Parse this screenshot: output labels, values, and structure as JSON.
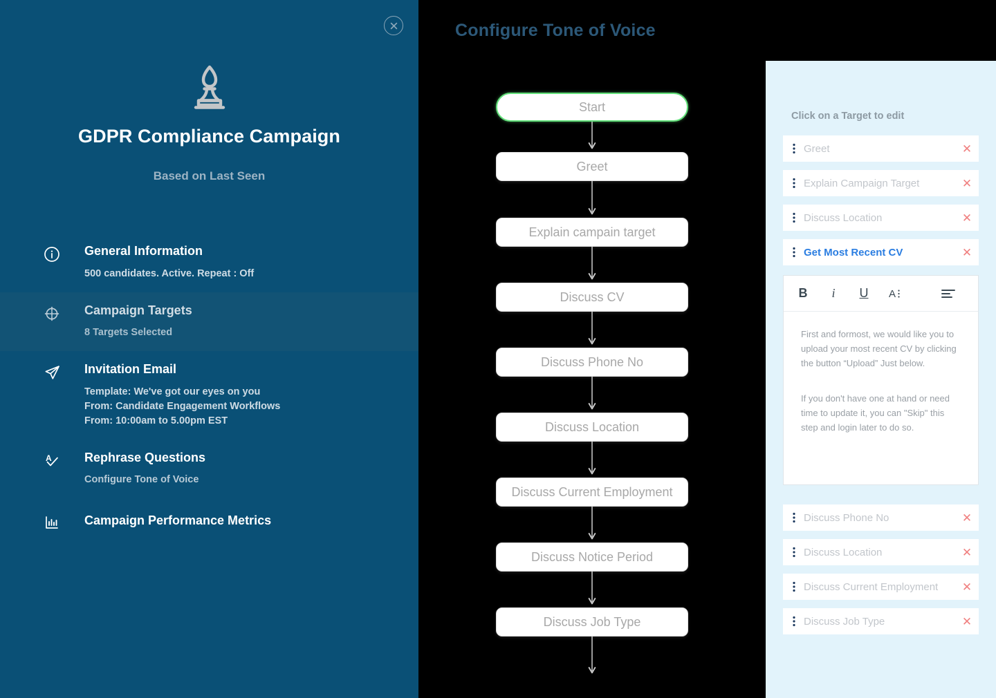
{
  "sidebar": {
    "close_icon": "close-circle-icon",
    "brand_icon": "chess-bishop-icon",
    "title": "GDPR Compliance Campaign",
    "subtitle": "Based on Last Seen",
    "items": [
      {
        "icon": "info-circle-icon",
        "label": "General Information",
        "sub": "500 candidates. Active. Repeat : Off",
        "active": false
      },
      {
        "icon": "target-crosshair-icon",
        "label": "Campaign Targets",
        "sub": "8 Targets Selected",
        "active": true
      },
      {
        "icon": "paper-plane-icon",
        "label": "Invitation Email",
        "sub_line1": "Template: We've got our eyes on you",
        "sub_line2": "From: Candidate Engagement Workflows",
        "sub_line3": "From: 10:00am to 5.00pm EST",
        "active": false
      },
      {
        "icon": "rephrase-a-check-icon",
        "label": "Rephrase Questions",
        "sub": "Configure Tone of Voice",
        "active": false
      },
      {
        "icon": "bar-chart-icon",
        "label": "Campaign Performance Metrics",
        "sub": "",
        "active": false
      }
    ]
  },
  "topbar": {
    "title": "Configure Tone of Voice"
  },
  "flow": {
    "nodes": [
      {
        "label": "Start",
        "type": "start"
      },
      {
        "label": "Greet",
        "type": "step"
      },
      {
        "label": "Explain campain target",
        "type": "step"
      },
      {
        "label": "Discuss CV",
        "type": "step"
      },
      {
        "label": "Discuss Phone No",
        "type": "step"
      },
      {
        "label": "Discuss Location",
        "type": "step"
      },
      {
        "label": "Discuss Current Employment",
        "type": "step"
      },
      {
        "label": "Discuss Notice Period",
        "type": "step"
      },
      {
        "label": "Discuss Job Type",
        "type": "step"
      }
    ]
  },
  "right_panel": {
    "hint": "Click on a  Target to edit",
    "targets_upper": [
      {
        "label": "Greet",
        "selected": false,
        "remove_icon": "close-icon"
      },
      {
        "label": "Explain Campaign Target",
        "selected": false,
        "remove_icon": "close-icon"
      },
      {
        "label": "Discuss Location",
        "selected": false,
        "remove_icon": "close-icon"
      },
      {
        "label": "Get Most Recent CV",
        "selected": true,
        "remove_icon": "close-icon"
      }
    ],
    "editor": {
      "toolbar": [
        {
          "name": "bold-button",
          "label": "B"
        },
        {
          "name": "italic-button",
          "label": "i"
        },
        {
          "name": "underline-button",
          "label": "U"
        },
        {
          "name": "font-size-button",
          "label": "A"
        },
        {
          "name": "align-left-button",
          "label": "align"
        },
        {
          "name": "align-more-button",
          "label": "more"
        }
      ],
      "paragraphs": [
        "First and formost, we would like you to upload your most recent CV by clicking the button “Upload” Just below.",
        "If you don't have one at hand or need time to update it, you can \"Skip\" this step and login later to do so."
      ]
    },
    "targets_lower": [
      {
        "label": "Discuss Phone No",
        "selected": false,
        "remove_icon": "close-icon"
      },
      {
        "label": "Discuss Location",
        "selected": false,
        "remove_icon": "close-icon"
      },
      {
        "label": "Discuss Current Employment",
        "selected": false,
        "remove_icon": "close-icon"
      },
      {
        "label": "Discuss Job Type",
        "selected": false,
        "remove_icon": "close-icon"
      }
    ]
  },
  "colors": {
    "sidebar_bg": "#0a5076",
    "sidebar_active": "#125375",
    "center_bg": "#000000",
    "right_bg": "#e2f3fb",
    "accent_blue": "#2a7de1",
    "start_green": "#62e07a",
    "remove_red": "#f08080",
    "topbar_title": "#2c5878"
  }
}
